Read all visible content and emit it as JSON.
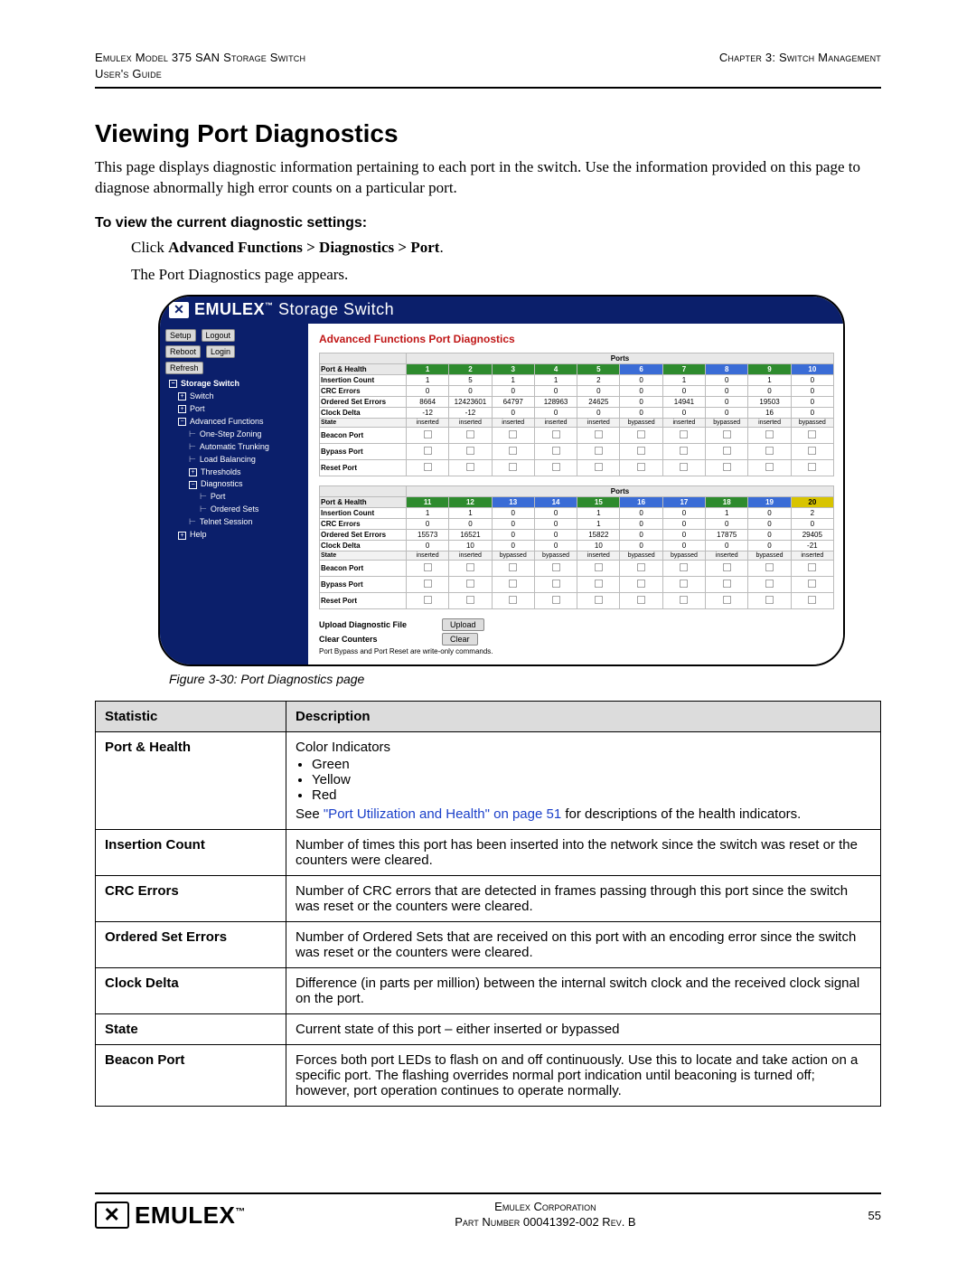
{
  "header": {
    "left1": "Emulex Model 375 SAN Storage Switch",
    "left2": "User's Guide",
    "right1": "",
    "right2": "Chapter 3: Switch Management"
  },
  "title": "Viewing Port Diagnostics",
  "intro": "This page displays diagnostic information pertaining to each port in the switch. Use the information provided on this page to diagnose abnormally high error counts on a particular port.",
  "proc_heading": "To view the current diagnostic settings:",
  "step_prefix": "Click ",
  "step_bold": "Advanced Functions > Diagnostics > Port",
  "step_suffix": ".",
  "result_text": "The Port Diagnostics page appears.",
  "caption": "Figure 3-30: Port Diagnostics page",
  "screenshot": {
    "brand_text": "EMULEX",
    "brand_suffix": " Storage Switch",
    "side_buttons": {
      "r1a": "Setup",
      "r1b": "Logout",
      "r2a": "Reboot",
      "r2b": "Login",
      "r3a": "Refresh"
    },
    "tree": {
      "root": "Storage Switch",
      "items": [
        {
          "lvl": 2,
          "exp": "+",
          "label": "Switch"
        },
        {
          "lvl": 2,
          "exp": "+",
          "label": "Port"
        },
        {
          "lvl": 2,
          "exp": "-",
          "label": "Advanced Functions"
        },
        {
          "lvl": 3,
          "exp": "",
          "label": "One-Step Zoning",
          "leaf": true
        },
        {
          "lvl": 3,
          "exp": "",
          "label": "Automatic Trunking",
          "leaf": true
        },
        {
          "lvl": 3,
          "exp": "",
          "label": "Load Balancing",
          "leaf": true
        },
        {
          "lvl": 3,
          "exp": "+",
          "label": "Thresholds"
        },
        {
          "lvl": 3,
          "exp": "-",
          "label": "Diagnostics"
        },
        {
          "lvl": 4,
          "exp": "",
          "label": "Port",
          "leaf": true
        },
        {
          "lvl": 4,
          "exp": "",
          "label": "Ordered Sets",
          "leaf": true
        },
        {
          "lvl": 3,
          "exp": "",
          "label": "Telnet Session",
          "leaf": true
        },
        {
          "lvl": 2,
          "exp": "+",
          "label": "Help"
        }
      ]
    },
    "content_title": "Advanced Functions Port Diagnostics",
    "ports_lbl": "Ports",
    "row_labels": {
      "ph": "Port & Health",
      "ic": "Insertion Count",
      "crc": "CRC Errors",
      "ose": "Ordered Set Errors",
      "cd": "Clock Delta",
      "st": "State",
      "bp": "Beacon Port",
      "byp": "Bypass Port",
      "rp": "Reset Port"
    },
    "group1": {
      "health": [
        {
          "n": "1",
          "c": "g"
        },
        {
          "n": "2",
          "c": "g"
        },
        {
          "n": "3",
          "c": "g"
        },
        {
          "n": "4",
          "c": "g"
        },
        {
          "n": "5",
          "c": "g"
        },
        {
          "n": "6",
          "c": "b"
        },
        {
          "n": "7",
          "c": "g"
        },
        {
          "n": "8",
          "c": "b"
        },
        {
          "n": "9",
          "c": "g"
        },
        {
          "n": "10",
          "c": "b"
        }
      ],
      "ic": [
        "1",
        "5",
        "1",
        "1",
        "2",
        "0",
        "1",
        "0",
        "1",
        "0"
      ],
      "crc": [
        "0",
        "0",
        "0",
        "0",
        "0",
        "0",
        "0",
        "0",
        "0",
        "0"
      ],
      "ose": [
        "8664",
        "12423601",
        "64797",
        "128963",
        "24625",
        "0",
        "14941",
        "0",
        "19503",
        "0"
      ],
      "cd": [
        "-12",
        "-12",
        "0",
        "0",
        "0",
        "0",
        "0",
        "0",
        "16",
        "0"
      ],
      "st": [
        "inserted",
        "inserted",
        "inserted",
        "inserted",
        "inserted",
        "bypassed",
        "inserted",
        "bypassed",
        "inserted",
        "bypassed"
      ]
    },
    "group2": {
      "health": [
        {
          "n": "11",
          "c": "g"
        },
        {
          "n": "12",
          "c": "g"
        },
        {
          "n": "13",
          "c": "b"
        },
        {
          "n": "14",
          "c": "b"
        },
        {
          "n": "15",
          "c": "g"
        },
        {
          "n": "16",
          "c": "b"
        },
        {
          "n": "17",
          "c": "b"
        },
        {
          "n": "18",
          "c": "g"
        },
        {
          "n": "19",
          "c": "b"
        },
        {
          "n": "20",
          "c": "y"
        }
      ],
      "ic": [
        "1",
        "1",
        "0",
        "0",
        "1",
        "0",
        "0",
        "1",
        "0",
        "2"
      ],
      "crc": [
        "0",
        "0",
        "0",
        "0",
        "1",
        "0",
        "0",
        "0",
        "0",
        "0"
      ],
      "ose": [
        "15573",
        "16521",
        "0",
        "0",
        "15822",
        "0",
        "0",
        "17875",
        "0",
        "29405"
      ],
      "cd": [
        "0",
        "10",
        "0",
        "0",
        "10",
        "0",
        "0",
        "0",
        "0",
        "-21"
      ],
      "st": [
        "inserted",
        "inserted",
        "bypassed",
        "bypassed",
        "inserted",
        "bypassed",
        "bypassed",
        "inserted",
        "bypassed",
        "inserted"
      ]
    },
    "under": {
      "upload_lbl": "Upload Diagnostic File",
      "upload_btn": "Upload",
      "clear_lbl": "Clear Counters",
      "clear_btn": "Clear",
      "note": "Port Bypass and Port Reset are write-only commands."
    }
  },
  "stat_table": {
    "h1": "Statistic",
    "h2": "Description",
    "rows": [
      {
        "term": "Port & Health",
        "lead": "Color Indicators",
        "bullets": [
          "Green",
          "Yellow",
          "Red"
        ],
        "tail_pre": "See ",
        "tail_link": "\"Port Utilization and Health\" on page 51",
        "tail_post": " for descriptions of the health indicators."
      },
      {
        "term": "Insertion Count",
        "desc": "Number of times this port has been inserted into the network since the switch was reset or the counters were cleared."
      },
      {
        "term": "CRC Errors",
        "desc": "Number of CRC errors that are detected in frames passing through this port since the switch was reset or the counters were cleared."
      },
      {
        "term": "Ordered Set Errors",
        "desc": "Number of Ordered Sets that are received on this port with an encoding error since the switch was reset or the counters were cleared."
      },
      {
        "term": "Clock Delta",
        "desc": "Difference (in parts per million) between the internal switch clock and the received clock signal on the port."
      },
      {
        "term": "State",
        "desc": "Current state of this port – either inserted or bypassed"
      },
      {
        "term": "Beacon Port",
        "desc": "Forces both port LEDs to flash on and off continuously. Use this to locate and take action on a specific port. The flashing overrides normal port indication until beaconing is turned off; however, port operation continues to operate normally."
      }
    ]
  },
  "footer": {
    "logo": "EMULEX",
    "line1": "Emulex Corporation",
    "line2": "Part Number 00041392-002 Rev. B",
    "page": "55"
  }
}
